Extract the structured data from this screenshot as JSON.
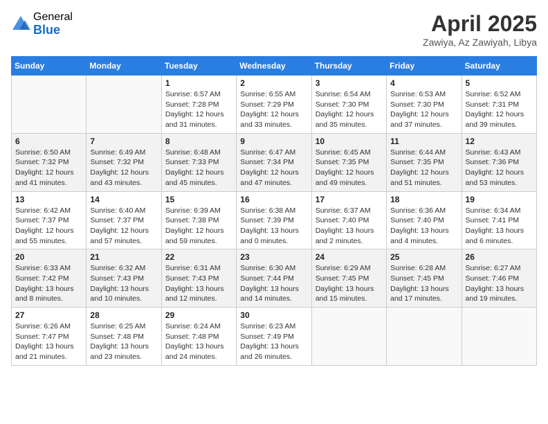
{
  "header": {
    "logo_general": "General",
    "logo_blue": "Blue",
    "month_title": "April 2025",
    "location": "Zawiya, Az Zawiyah, Libya"
  },
  "weekdays": [
    "Sunday",
    "Monday",
    "Tuesday",
    "Wednesday",
    "Thursday",
    "Friday",
    "Saturday"
  ],
  "weeks": [
    [
      {
        "day": "",
        "detail": ""
      },
      {
        "day": "",
        "detail": ""
      },
      {
        "day": "1",
        "detail": "Sunrise: 6:57 AM\nSunset: 7:28 PM\nDaylight: 12 hours and 31 minutes."
      },
      {
        "day": "2",
        "detail": "Sunrise: 6:55 AM\nSunset: 7:29 PM\nDaylight: 12 hours and 33 minutes."
      },
      {
        "day": "3",
        "detail": "Sunrise: 6:54 AM\nSunset: 7:30 PM\nDaylight: 12 hours and 35 minutes."
      },
      {
        "day": "4",
        "detail": "Sunrise: 6:53 AM\nSunset: 7:30 PM\nDaylight: 12 hours and 37 minutes."
      },
      {
        "day": "5",
        "detail": "Sunrise: 6:52 AM\nSunset: 7:31 PM\nDaylight: 12 hours and 39 minutes."
      }
    ],
    [
      {
        "day": "6",
        "detail": "Sunrise: 6:50 AM\nSunset: 7:32 PM\nDaylight: 12 hours and 41 minutes."
      },
      {
        "day": "7",
        "detail": "Sunrise: 6:49 AM\nSunset: 7:32 PM\nDaylight: 12 hours and 43 minutes."
      },
      {
        "day": "8",
        "detail": "Sunrise: 6:48 AM\nSunset: 7:33 PM\nDaylight: 12 hours and 45 minutes."
      },
      {
        "day": "9",
        "detail": "Sunrise: 6:47 AM\nSunset: 7:34 PM\nDaylight: 12 hours and 47 minutes."
      },
      {
        "day": "10",
        "detail": "Sunrise: 6:45 AM\nSunset: 7:35 PM\nDaylight: 12 hours and 49 minutes."
      },
      {
        "day": "11",
        "detail": "Sunrise: 6:44 AM\nSunset: 7:35 PM\nDaylight: 12 hours and 51 minutes."
      },
      {
        "day": "12",
        "detail": "Sunrise: 6:43 AM\nSunset: 7:36 PM\nDaylight: 12 hours and 53 minutes."
      }
    ],
    [
      {
        "day": "13",
        "detail": "Sunrise: 6:42 AM\nSunset: 7:37 PM\nDaylight: 12 hours and 55 minutes."
      },
      {
        "day": "14",
        "detail": "Sunrise: 6:40 AM\nSunset: 7:37 PM\nDaylight: 12 hours and 57 minutes."
      },
      {
        "day": "15",
        "detail": "Sunrise: 6:39 AM\nSunset: 7:38 PM\nDaylight: 12 hours and 59 minutes."
      },
      {
        "day": "16",
        "detail": "Sunrise: 6:38 AM\nSunset: 7:39 PM\nDaylight: 13 hours and 0 minutes."
      },
      {
        "day": "17",
        "detail": "Sunrise: 6:37 AM\nSunset: 7:40 PM\nDaylight: 13 hours and 2 minutes."
      },
      {
        "day": "18",
        "detail": "Sunrise: 6:36 AM\nSunset: 7:40 PM\nDaylight: 13 hours and 4 minutes."
      },
      {
        "day": "19",
        "detail": "Sunrise: 6:34 AM\nSunset: 7:41 PM\nDaylight: 13 hours and 6 minutes."
      }
    ],
    [
      {
        "day": "20",
        "detail": "Sunrise: 6:33 AM\nSunset: 7:42 PM\nDaylight: 13 hours and 8 minutes."
      },
      {
        "day": "21",
        "detail": "Sunrise: 6:32 AM\nSunset: 7:43 PM\nDaylight: 13 hours and 10 minutes."
      },
      {
        "day": "22",
        "detail": "Sunrise: 6:31 AM\nSunset: 7:43 PM\nDaylight: 13 hours and 12 minutes."
      },
      {
        "day": "23",
        "detail": "Sunrise: 6:30 AM\nSunset: 7:44 PM\nDaylight: 13 hours and 14 minutes."
      },
      {
        "day": "24",
        "detail": "Sunrise: 6:29 AM\nSunset: 7:45 PM\nDaylight: 13 hours and 15 minutes."
      },
      {
        "day": "25",
        "detail": "Sunrise: 6:28 AM\nSunset: 7:45 PM\nDaylight: 13 hours and 17 minutes."
      },
      {
        "day": "26",
        "detail": "Sunrise: 6:27 AM\nSunset: 7:46 PM\nDaylight: 13 hours and 19 minutes."
      }
    ],
    [
      {
        "day": "27",
        "detail": "Sunrise: 6:26 AM\nSunset: 7:47 PM\nDaylight: 13 hours and 21 minutes."
      },
      {
        "day": "28",
        "detail": "Sunrise: 6:25 AM\nSunset: 7:48 PM\nDaylight: 13 hours and 23 minutes."
      },
      {
        "day": "29",
        "detail": "Sunrise: 6:24 AM\nSunset: 7:48 PM\nDaylight: 13 hours and 24 minutes."
      },
      {
        "day": "30",
        "detail": "Sunrise: 6:23 AM\nSunset: 7:49 PM\nDaylight: 13 hours and 26 minutes."
      },
      {
        "day": "",
        "detail": ""
      },
      {
        "day": "",
        "detail": ""
      },
      {
        "day": "",
        "detail": ""
      }
    ]
  ]
}
